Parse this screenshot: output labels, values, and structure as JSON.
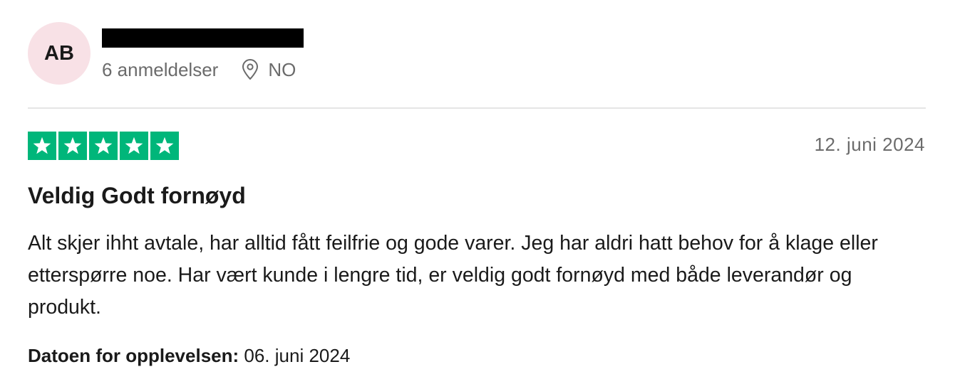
{
  "reviewer": {
    "initials": "AB",
    "review_count": "6 anmeldelser",
    "country": "NO"
  },
  "rating": {
    "stars": 5,
    "max": 5,
    "color": "#00b67a"
  },
  "review": {
    "date": "12. juni 2024",
    "title": "Veldig Godt fornøyd",
    "text": "Alt skjer ihht avtale, har alltid fått feilfrie og gode varer. Jeg har aldri hatt behov for å klage eller etterspørre noe. Har vært kunde i lengre tid, er veldig godt fornøyd med både leverandør og produkt.",
    "experience_label": "Datoen for opplevelsen:",
    "experience_date": "06. juni 2024"
  },
  "icons": {
    "location": "location-pin-icon",
    "star": "star-icon"
  },
  "colors": {
    "avatar_bg": "#f8e1e6",
    "star_bg": "#00b67a",
    "muted_text": "#6b6b6b"
  }
}
